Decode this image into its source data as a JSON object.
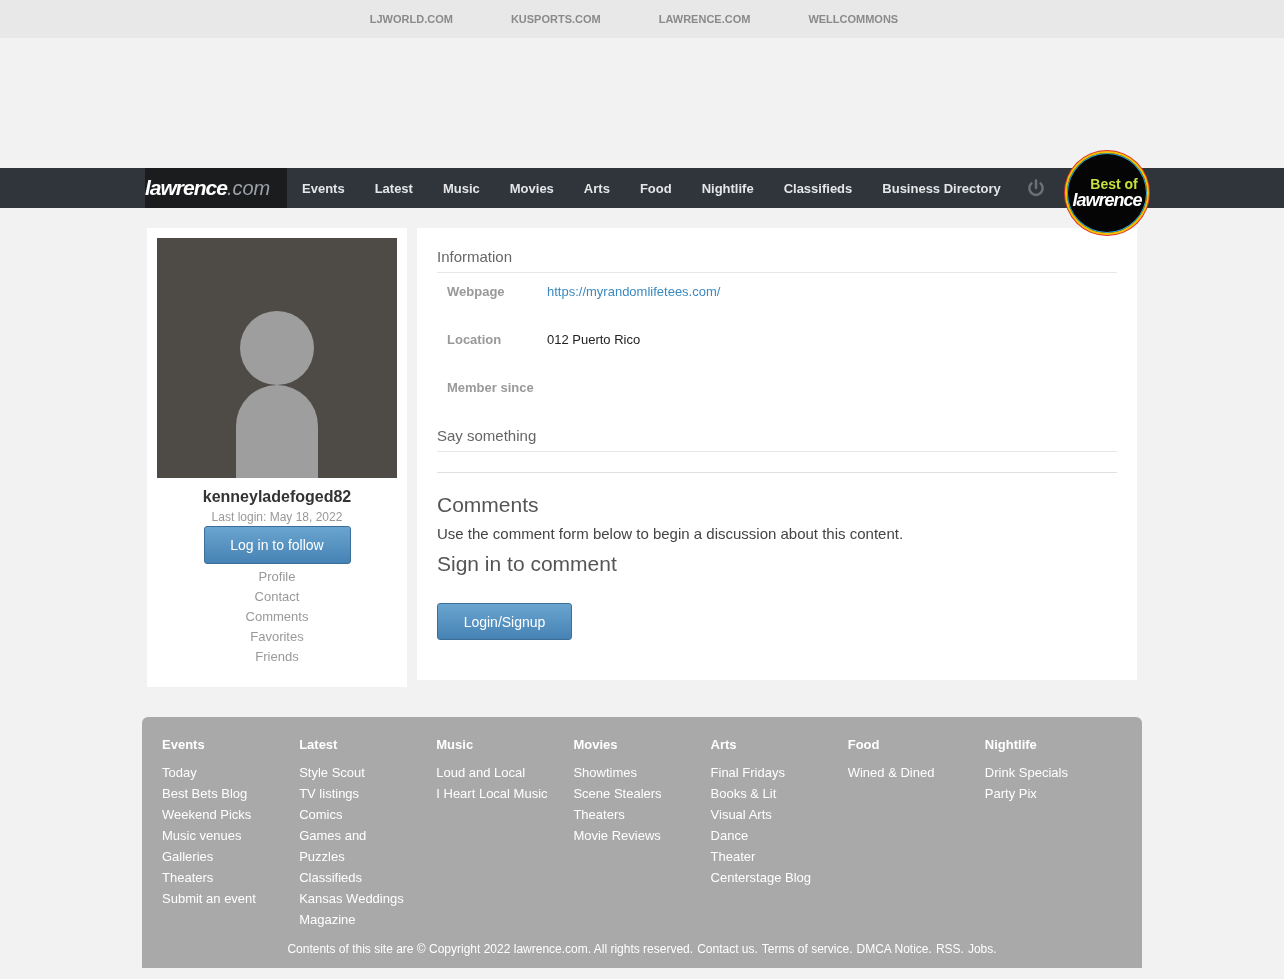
{
  "top_links": [
    "LJWORLD.COM",
    "KUSPORTS.COM",
    "LAWRENCE.COM",
    "WELLCOMMONS"
  ],
  "nav": {
    "logo": {
      "main": "lawrence",
      "suffix": ".com"
    },
    "items": [
      {
        "label": "Events",
        "selected": false
      },
      {
        "label": "Latest",
        "selected": false
      },
      {
        "label": "Music",
        "selected": false
      },
      {
        "label": "Movies",
        "selected": false
      },
      {
        "label": "Arts",
        "selected": false
      },
      {
        "label": "Food",
        "selected": false
      },
      {
        "label": "Nightlife",
        "selected": false
      },
      {
        "label": "Classifieds",
        "selected": false
      },
      {
        "label": "Business Directory",
        "selected": false
      }
    ],
    "badge": {
      "top": "Best of",
      "bottom": "lawrence"
    }
  },
  "profile": {
    "username": "kenneyladefoged82",
    "last_login": "Last login: May 18, 2022",
    "follow_button": "Log in to follow",
    "links": [
      "Profile",
      "Contact",
      "Comments",
      "Favorites",
      "Friends"
    ]
  },
  "information": {
    "title": "Information",
    "fields": [
      {
        "label": "Webpage",
        "value": "https://myrandomlifetees.com/",
        "kind": "link"
      },
      {
        "label": "Location",
        "value": "012 Puerto Rico",
        "kind": "text"
      },
      {
        "label": "Member since"
      }
    ]
  },
  "say_something": {
    "title": "Say something"
  },
  "comments": {
    "title": "Comments",
    "description": "Use the comment form below to begin a discussion about this content.",
    "signin_title": "Sign in to comment",
    "button": "Login/Signup"
  },
  "footer": {
    "columns": [
      {
        "heading": "Events",
        "links": [
          "Today",
          "Best Bets Blog",
          "Weekend Picks",
          "Music venues",
          "Galleries",
          "Theaters",
          "Submit an event"
        ]
      },
      {
        "heading": "Latest",
        "links": [
          "Style Scout",
          "TV listings",
          "Comics",
          "Games and Puzzles",
          "Classifieds",
          "Kansas Weddings Magazine"
        ]
      },
      {
        "heading": "Music",
        "links": [
          "Loud and Local",
          "I Heart Local Music"
        ]
      },
      {
        "heading": "Movies",
        "links": [
          "Showtimes",
          "Scene Stealers",
          "Theaters",
          "Movie Reviews"
        ]
      },
      {
        "heading": "Arts",
        "links": [
          "Final Fridays",
          "Books & Lit",
          "Visual Arts",
          "Dance",
          "Theater",
          "Centerstage Blog"
        ]
      },
      {
        "heading": "Food",
        "links": [
          "Wined & Dined"
        ]
      },
      {
        "heading": "Nightlife",
        "links": [
          "Drink Specials",
          "Party Pix"
        ]
      }
    ],
    "copyright": "Contents of this site are © Copyright 2022 lawrence.com. All rights reserved.",
    "links": [
      "Contact us.",
      "Terms of service.",
      "DMCA Notice.",
      "RSS.",
      "Jobs."
    ]
  }
}
